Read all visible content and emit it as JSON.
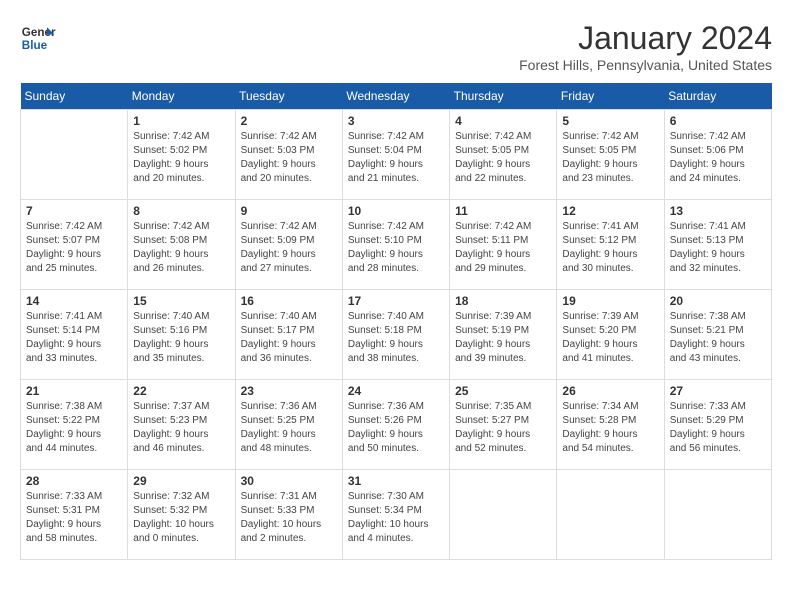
{
  "logo": {
    "line1": "General",
    "line2": "Blue"
  },
  "title": "January 2024",
  "location": "Forest Hills, Pennsylvania, United States",
  "days_of_week": [
    "Sunday",
    "Monday",
    "Tuesday",
    "Wednesday",
    "Thursday",
    "Friday",
    "Saturday"
  ],
  "weeks": [
    [
      {
        "num": "",
        "info": ""
      },
      {
        "num": "1",
        "info": "Sunrise: 7:42 AM\nSunset: 5:02 PM\nDaylight: 9 hours\nand 20 minutes."
      },
      {
        "num": "2",
        "info": "Sunrise: 7:42 AM\nSunset: 5:03 PM\nDaylight: 9 hours\nand 20 minutes."
      },
      {
        "num": "3",
        "info": "Sunrise: 7:42 AM\nSunset: 5:04 PM\nDaylight: 9 hours\nand 21 minutes."
      },
      {
        "num": "4",
        "info": "Sunrise: 7:42 AM\nSunset: 5:05 PM\nDaylight: 9 hours\nand 22 minutes."
      },
      {
        "num": "5",
        "info": "Sunrise: 7:42 AM\nSunset: 5:05 PM\nDaylight: 9 hours\nand 23 minutes."
      },
      {
        "num": "6",
        "info": "Sunrise: 7:42 AM\nSunset: 5:06 PM\nDaylight: 9 hours\nand 24 minutes."
      }
    ],
    [
      {
        "num": "7",
        "info": "Sunrise: 7:42 AM\nSunset: 5:07 PM\nDaylight: 9 hours\nand 25 minutes."
      },
      {
        "num": "8",
        "info": "Sunrise: 7:42 AM\nSunset: 5:08 PM\nDaylight: 9 hours\nand 26 minutes."
      },
      {
        "num": "9",
        "info": "Sunrise: 7:42 AM\nSunset: 5:09 PM\nDaylight: 9 hours\nand 27 minutes."
      },
      {
        "num": "10",
        "info": "Sunrise: 7:42 AM\nSunset: 5:10 PM\nDaylight: 9 hours\nand 28 minutes."
      },
      {
        "num": "11",
        "info": "Sunrise: 7:42 AM\nSunset: 5:11 PM\nDaylight: 9 hours\nand 29 minutes."
      },
      {
        "num": "12",
        "info": "Sunrise: 7:41 AM\nSunset: 5:12 PM\nDaylight: 9 hours\nand 30 minutes."
      },
      {
        "num": "13",
        "info": "Sunrise: 7:41 AM\nSunset: 5:13 PM\nDaylight: 9 hours\nand 32 minutes."
      }
    ],
    [
      {
        "num": "14",
        "info": "Sunrise: 7:41 AM\nSunset: 5:14 PM\nDaylight: 9 hours\nand 33 minutes."
      },
      {
        "num": "15",
        "info": "Sunrise: 7:40 AM\nSunset: 5:16 PM\nDaylight: 9 hours\nand 35 minutes."
      },
      {
        "num": "16",
        "info": "Sunrise: 7:40 AM\nSunset: 5:17 PM\nDaylight: 9 hours\nand 36 minutes."
      },
      {
        "num": "17",
        "info": "Sunrise: 7:40 AM\nSunset: 5:18 PM\nDaylight: 9 hours\nand 38 minutes."
      },
      {
        "num": "18",
        "info": "Sunrise: 7:39 AM\nSunset: 5:19 PM\nDaylight: 9 hours\nand 39 minutes."
      },
      {
        "num": "19",
        "info": "Sunrise: 7:39 AM\nSunset: 5:20 PM\nDaylight: 9 hours\nand 41 minutes."
      },
      {
        "num": "20",
        "info": "Sunrise: 7:38 AM\nSunset: 5:21 PM\nDaylight: 9 hours\nand 43 minutes."
      }
    ],
    [
      {
        "num": "21",
        "info": "Sunrise: 7:38 AM\nSunset: 5:22 PM\nDaylight: 9 hours\nand 44 minutes."
      },
      {
        "num": "22",
        "info": "Sunrise: 7:37 AM\nSunset: 5:23 PM\nDaylight: 9 hours\nand 46 minutes."
      },
      {
        "num": "23",
        "info": "Sunrise: 7:36 AM\nSunset: 5:25 PM\nDaylight: 9 hours\nand 48 minutes."
      },
      {
        "num": "24",
        "info": "Sunrise: 7:36 AM\nSunset: 5:26 PM\nDaylight: 9 hours\nand 50 minutes."
      },
      {
        "num": "25",
        "info": "Sunrise: 7:35 AM\nSunset: 5:27 PM\nDaylight: 9 hours\nand 52 minutes."
      },
      {
        "num": "26",
        "info": "Sunrise: 7:34 AM\nSunset: 5:28 PM\nDaylight: 9 hours\nand 54 minutes."
      },
      {
        "num": "27",
        "info": "Sunrise: 7:33 AM\nSunset: 5:29 PM\nDaylight: 9 hours\nand 56 minutes."
      }
    ],
    [
      {
        "num": "28",
        "info": "Sunrise: 7:33 AM\nSunset: 5:31 PM\nDaylight: 9 hours\nand 58 minutes."
      },
      {
        "num": "29",
        "info": "Sunrise: 7:32 AM\nSunset: 5:32 PM\nDaylight: 10 hours\nand 0 minutes."
      },
      {
        "num": "30",
        "info": "Sunrise: 7:31 AM\nSunset: 5:33 PM\nDaylight: 10 hours\nand 2 minutes."
      },
      {
        "num": "31",
        "info": "Sunrise: 7:30 AM\nSunset: 5:34 PM\nDaylight: 10 hours\nand 4 minutes."
      },
      {
        "num": "",
        "info": ""
      },
      {
        "num": "",
        "info": ""
      },
      {
        "num": "",
        "info": ""
      }
    ]
  ]
}
